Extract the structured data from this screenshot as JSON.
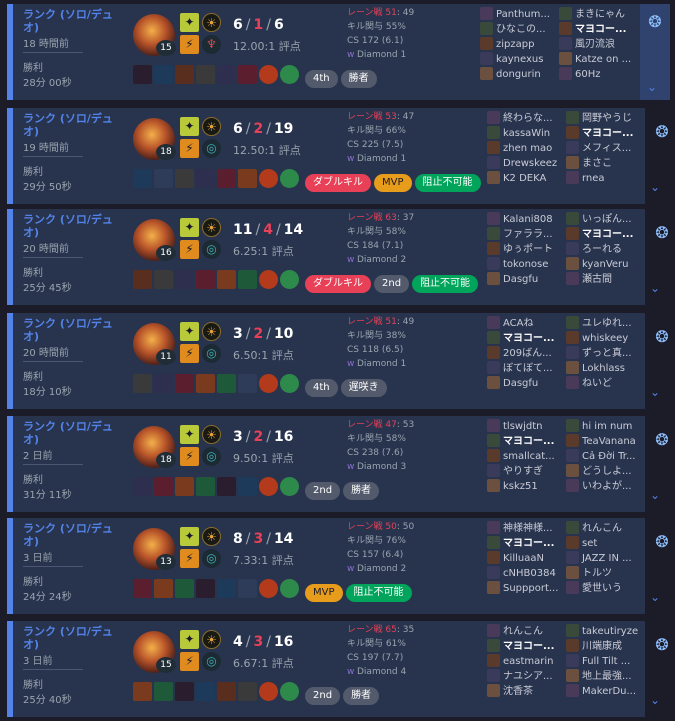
{
  "matches": [
    {
      "mode": "ランク (ソロ/デュオ)",
      "ago": "18 時間前",
      "result": "勝利",
      "duration": "28分 00秒",
      "level": "15",
      "kills": "6",
      "deaths": "1",
      "assists": "6",
      "ratio": "12.00:1 評点",
      "lane_label": "レーン戦 51",
      "lane_other": ": 49",
      "kp": "キル関与 55%",
      "cs": "CS 172 (6.1)",
      "tier": "Diamond 1",
      "badges": [
        {
          "text": "4th",
          "style": "gray"
        },
        {
          "text": "勝者",
          "style": "gray"
        }
      ],
      "team1": [
        "Panthum...",
        "ひなこの...",
        "zipzapp",
        "kaynexus",
        "dongurin"
      ],
      "team2": [
        "まきにゃん",
        "マヨコー...",
        "風刃流浪",
        "Katze on ...",
        "60Hz"
      ],
      "me_team": 2,
      "me_index": 1
    },
    {
      "mode": "ランク (ソロ/デュオ)",
      "ago": "19 時間前",
      "result": "勝利",
      "duration": "29分 50秒",
      "level": "18",
      "kills": "6",
      "deaths": "2",
      "assists": "19",
      "ratio": "12.50:1 評点",
      "lane_label": "レーン戦 53",
      "lane_other": ": 47",
      "kp": "キル関与 66%",
      "cs": "CS 225 (7.5)",
      "tier": "Diamond 1",
      "badges": [
        {
          "text": "ダブルキル",
          "style": "red"
        },
        {
          "text": "MVP",
          "style": "orange"
        },
        {
          "text": "阻止不可能",
          "style": "green"
        }
      ],
      "team1": [
        "終わらな...",
        "kassaWin",
        "zhen mao",
        "Drewskeez",
        "K2 DEKA"
      ],
      "team2": [
        "岡野やうじ",
        "マヨコー...",
        "メフィス...",
        "まさこ",
        "rnea"
      ],
      "me_team": 2,
      "me_index": 1
    },
    {
      "mode": "ランク (ソロ/デュオ)",
      "ago": "20 時間前",
      "result": "勝利",
      "duration": "25分 45秒",
      "level": "16",
      "kills": "11",
      "deaths": "4",
      "assists": "14",
      "ratio": "6.25:1 評点",
      "lane_label": "レーン戦 63",
      "lane_other": ": 37",
      "kp": "キル関与 58%",
      "cs": "CS 184 (7.1)",
      "tier": "Diamond 2",
      "badges": [
        {
          "text": "ダブルキル",
          "style": "red"
        },
        {
          "text": "2nd",
          "style": "gray"
        },
        {
          "text": "阻止不可能",
          "style": "green"
        }
      ],
      "team1": [
        "Kalani808",
        "ファララ...",
        "ゆぅポート",
        "tokonose",
        "Dasgfu"
      ],
      "team2": [
        "いっぽん...",
        "マヨコー...",
        "ろーれる",
        "kyanVeru",
        "瀬古間"
      ],
      "me_team": 2,
      "me_index": 1
    },
    {
      "mode": "ランク (ソロ/デュオ)",
      "ago": "20 時間前",
      "result": "勝利",
      "duration": "18分 10秒",
      "level": "11",
      "kills": "3",
      "deaths": "2",
      "assists": "10",
      "ratio": "6.50:1 評点",
      "lane_label": "レーン戦 51",
      "lane_other": ": 49",
      "kp": "キル関与 38%",
      "cs": "CS 118 (6.5)",
      "tier": "Diamond 1",
      "badges": [
        {
          "text": "4th",
          "style": "gray"
        },
        {
          "text": "遅咲き",
          "style": "gray"
        }
      ],
      "team1": [
        "ACAね",
        "マヨコー...",
        "209ばん...",
        "ぼてぼて...",
        "Dasgfu"
      ],
      "team2": [
        "ユレゆれ...",
        "whiskeey",
        "ずっと真...",
        "Lokhlass",
        "ねいど"
      ],
      "me_team": 1,
      "me_index": 1
    },
    {
      "mode": "ランク (ソロ/デュオ)",
      "ago": "2 日前",
      "result": "勝利",
      "duration": "31分 11秒",
      "level": "18",
      "kills": "3",
      "deaths": "2",
      "assists": "16",
      "ratio": "9.50:1 評点",
      "lane_label": "レーン戦 47",
      "lane_other": ": 53",
      "kp": "キル関与 58%",
      "cs": "CS 238 (7.6)",
      "tier": "Diamond 3",
      "badges": [
        {
          "text": "2nd",
          "style": "gray"
        },
        {
          "text": "勝者",
          "style": "gray"
        }
      ],
      "team1": [
        "tlswjdtn",
        "マヨコー...",
        "smallcat...",
        "やりすぎ",
        "kskz51"
      ],
      "team2": [
        "hi im num",
        "TeaVanana",
        "Cả Đời Tr...",
        "どうしよ...",
        "いわよが..."
      ],
      "me_team": 1,
      "me_index": 1
    },
    {
      "mode": "ランク (ソロ/デュオ)",
      "ago": "3 日前",
      "result": "勝利",
      "duration": "24分 24秒",
      "level": "13",
      "kills": "8",
      "deaths": "3",
      "assists": "14",
      "ratio": "7.33:1 評点",
      "lane_label": "レーン戦 50",
      "lane_other": ": 50",
      "kp": "キル関与 76%",
      "cs": "CS 157 (6.4)",
      "tier": "Diamond 2",
      "badges": [
        {
          "text": "MVP",
          "style": "orange"
        },
        {
          "text": "阻止不可能",
          "style": "green"
        }
      ],
      "team1": [
        "神様神様...",
        "マヨコー...",
        "KilluaaN",
        "cNHB0384",
        "Suppport..."
      ],
      "team2": [
        "れんこん",
        "set",
        "JAZZ IN ...",
        "トルツ",
        "愛世いう"
      ],
      "me_team": 1,
      "me_index": 1
    },
    {
      "mode": "ランク (ソロ/デュオ)",
      "ago": "3 日前",
      "result": "勝利",
      "duration": "25分 40秒",
      "level": "15",
      "kills": "4",
      "deaths": "3",
      "assists": "16",
      "ratio": "6.67:1 評点",
      "lane_label": "レーン戦 65",
      "lane_other": ": 35",
      "kp": "キル関与 61%",
      "cs": "CS 197 (7.7)",
      "tier": "Diamond 4",
      "badges": [
        {
          "text": "2nd",
          "style": "gray"
        },
        {
          "text": "勝者",
          "style": "gray"
        }
      ],
      "team1": [
        "れんこん",
        "マヨコー...",
        "eastmarin",
        "ナユシア...",
        "沈香茶"
      ],
      "team2": [
        "takeutiryze",
        "川端康成",
        "Full Tilt ...",
        "地上最強...",
        "MakerDu..."
      ],
      "me_team": 1,
      "me_index": 1
    }
  ]
}
